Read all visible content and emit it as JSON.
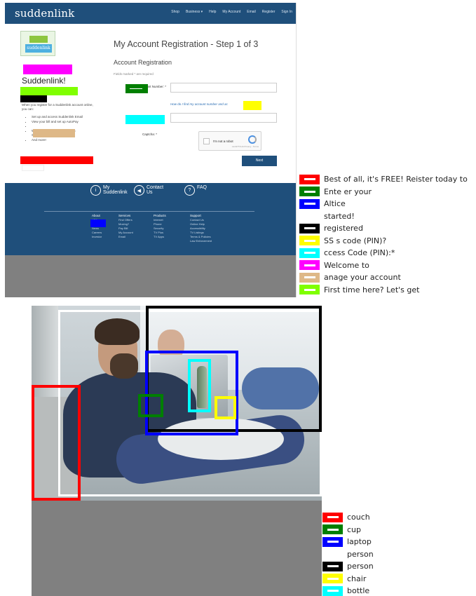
{
  "screenshot": {
    "logo": "suddenlink",
    "nav_links": [
      "Shop",
      "Business ▾",
      "Help",
      "My Account",
      "Email",
      "Register",
      "Sign In"
    ],
    "sidebar": {
      "heading": "Suddenlink!",
      "intro": "When you register for a Suddenlink account online, you can:",
      "bullets": [
        "Set up and access Suddenlink Email",
        "View your bill and set up AutoPay",
        "",
        "Watch TV shows for FREE with Suddenlink2GO®",
        "And more!"
      ]
    },
    "main": {
      "title": "My Account Registration - Step 1 of 3",
      "section": "Account Registration",
      "required_note": "Fields marked * are required",
      "account_label": "Account Number: *",
      "find_link": "How do I find my account number and ac",
      "captcha_label": "Captcha: *",
      "captcha_text": "I'm not a robot",
      "captcha_brand": "reCAPTCHA\nPrivacy - Terms",
      "next_button": "Next"
    },
    "footer": {
      "icons": [
        {
          "icon": "info-circle-icon",
          "label": "My\nSuddenlink"
        },
        {
          "icon": "megaphone-icon",
          "label": "Contact\nUs"
        },
        {
          "icon": "question-circle-icon",
          "label": "FAQ"
        }
      ],
      "columns": [
        {
          "title": "About",
          "items": [
            "",
            "USA",
            "Leadership",
            "News",
            "Careers",
            "Investor"
          ]
        },
        {
          "title": "Services",
          "items": [
            "Find Offers",
            "Moving?",
            "Pay Bill",
            "My Account",
            "Email"
          ]
        },
        {
          "title": "Products",
          "items": [
            "Internet",
            "Phone",
            "Security",
            "TV Plus",
            "TV Apps"
          ]
        },
        {
          "title": "Support",
          "items": [
            "Contact Us",
            "Online Help",
            "Accessibility",
            "TV Listings",
            "Terms & Policies",
            "Law Enforcement"
          ]
        }
      ]
    }
  },
  "legend_top": [
    {
      "color": "#ff0000",
      "label": "Best of all, it's FREE! Reister today to"
    },
    {
      "color": "#007f00",
      "label": "Ente er your"
    },
    {
      "color": "#0000ff",
      "label": "Altice"
    },
    {
      "color": "",
      "label": "started!"
    },
    {
      "color": "#000000",
      "label": "registered"
    },
    {
      "color": "#ffff00",
      "label": "SS s code (PIN)?"
    },
    {
      "color": "#00ffff",
      "label": "ccess Code (PIN):*"
    },
    {
      "color": "#ff00ff",
      "label": "Welcome to"
    },
    {
      "color": "#deb887",
      "label": "anage your account"
    },
    {
      "color": "#80ff00",
      "label": "First time here? Let's get"
    }
  ],
  "legend_bottom": [
    {
      "color": "#ff0000",
      "label": "couch"
    },
    {
      "color": "#007f00",
      "label": "cup"
    },
    {
      "color": "#0000ff",
      "label": "laptop"
    },
    {
      "color": "",
      "label": "person"
    },
    {
      "color": "#000000",
      "label": "person"
    },
    {
      "color": "#ffff00",
      "label": "chair"
    },
    {
      "color": "#00ffff",
      "label": "bottle"
    }
  ]
}
